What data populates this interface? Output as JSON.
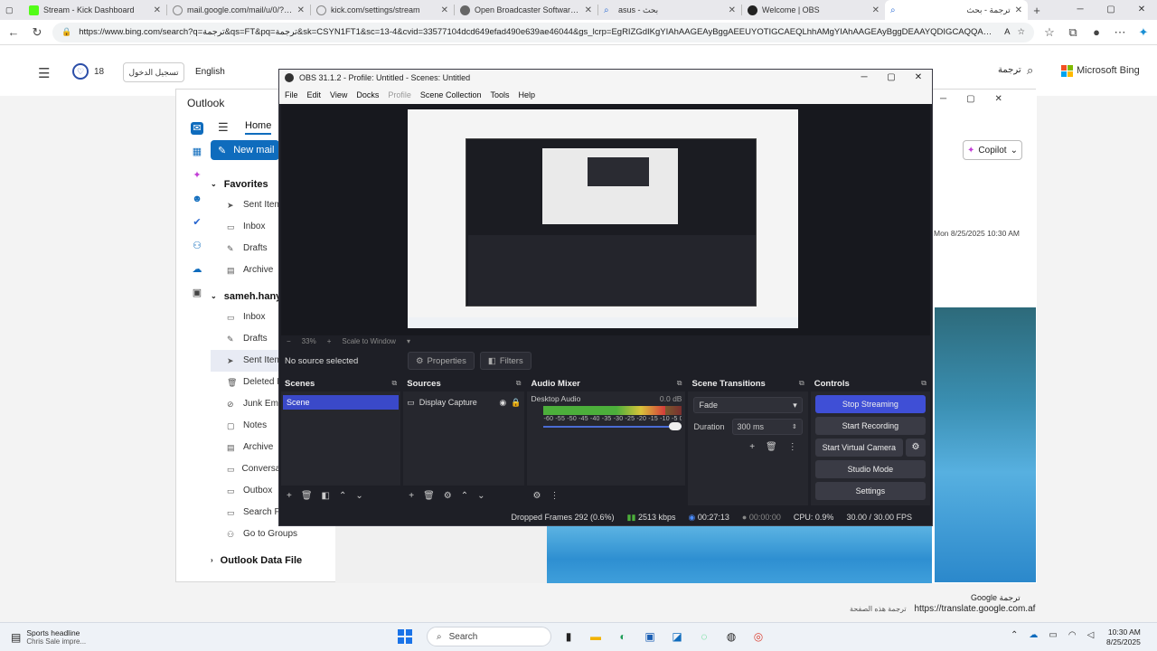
{
  "browser": {
    "tabs": [
      {
        "label": "Stream - Kick Dashboard",
        "color": "#53fc18"
      },
      {
        "label": "mail.google.com/mail/u/0/?tab=...",
        "color": "#888888"
      },
      {
        "label": "kick.com/settings/stream",
        "color": "#888888"
      },
      {
        "label": "Open Broadcaster Software | OBS",
        "color": "#666666"
      },
      {
        "label": "asus - بحث",
        "color": "#2b6cd4"
      },
      {
        "label": "Welcome | OBS",
        "color": "#222222"
      },
      {
        "label": "ترجمة - بحث",
        "color": "#2b6cd4"
      }
    ],
    "url": "https://www.bing.com/search?q=ترجمة&qs=FT&pq=ترجمة&sk=CSYN1FT1&sc=13-4&cvid=33577104dcd649efad490e639ae46044&gs_lcrp=EgRIZGdIKgYIAhAAGEAyBggAEEUYOTIGCAEQLhhAMgYIAhAAGEAyBggDEAAYQDIGCAQQABhAMgYIBRAAGEAyBggq..."
  },
  "bing": {
    "rewards_count": "18",
    "signin": "تسجيل الدخول",
    "language": "English",
    "query": "ترجمة",
    "brand": "Microsoft Bing",
    "translate_label": "Google ترجمة",
    "translate_url": "https://translate.google.com.af",
    "translate_note": "ترجمة هذه الصفحة"
  },
  "outlook": {
    "title": "Outlook",
    "home_tab": "Home",
    "new_mail": "New mail",
    "favorites_header": "Favorites",
    "favorites": [
      "Sent Items",
      "Inbox",
      "Drafts",
      "Archive"
    ],
    "account_header": "sameh.hany",
    "account_folders": [
      "Inbox",
      "Drafts",
      "Sent Items",
      "Deleted Items",
      "Junk Email",
      "Notes",
      "Archive",
      "Conversation History",
      "Outbox",
      "Search Folders",
      "Go to Groups"
    ],
    "selected_folder_index": 2,
    "data_file": "Outlook Data File",
    "copilot": "Copilot",
    "message_date": "Mon 8/25/2025 10:30 AM"
  },
  "obs": {
    "title": "OBS 31.1.2 - Profile: Untitled - Scenes: Untitled",
    "menu": [
      "File",
      "Edit",
      "View",
      "Docks",
      "Profile",
      "Scene Collection",
      "Tools",
      "Help"
    ],
    "zoom": "33%",
    "scale_mode": "Scale to Window",
    "no_source": "No source selected",
    "properties_btn": "Properties",
    "filters_btn": "Filters",
    "scenes_title": "Scenes",
    "scene_name": "Scene",
    "sources_title": "Sources",
    "source_name": "Display Capture",
    "mixer_title": "Audio Mixer",
    "mixer_channel": "Desktop Audio",
    "mixer_db": "0.0 dB",
    "mixer_ticks": "-60 -55 -50 -45 -40 -35 -30 -25 -20 -15 -10 -5 0",
    "mixer_level": 0.88,
    "transitions_title": "Scene Transitions",
    "transition": "Fade",
    "duration_label": "Duration",
    "duration_value": "300 ms",
    "controls_title": "Controls",
    "controls": {
      "stream": "Stop Streaming",
      "record": "Start Recording",
      "vcam": "Start Virtual Camera",
      "studio": "Studio Mode",
      "settings": "Settings"
    },
    "status": {
      "dropped": "Dropped Frames 292 (0.6%)",
      "bitrate": "2513 kbps",
      "stream_time": "00:27:13",
      "record_time": "00:00:00",
      "cpu": "CPU: 0.9%",
      "fps": "30.00 / 30.00 FPS"
    }
  },
  "taskbar": {
    "weather_title": "Sports headline",
    "weather_sub": "Chris Sale impre...",
    "search": "Search",
    "time": "10:30 AM",
    "date": "8/25/2025"
  }
}
